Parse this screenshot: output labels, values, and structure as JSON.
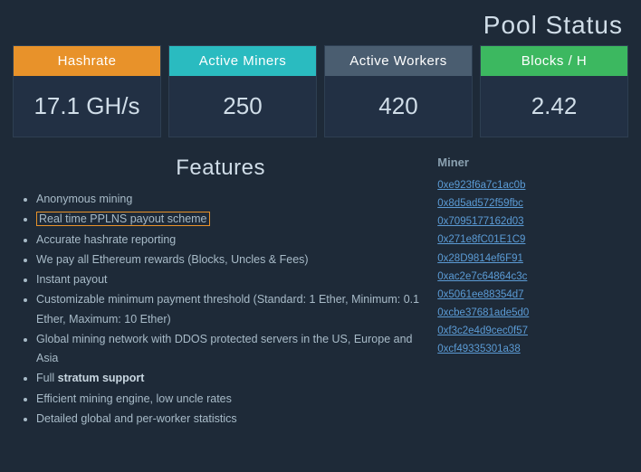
{
  "header": {
    "title": "Pool Status"
  },
  "stats": [
    {
      "id": "hashrate",
      "label": "Hashrate",
      "value": "17.1 GH/s",
      "color": "orange"
    },
    {
      "id": "active-miners",
      "label": "Active Miners",
      "value": "250",
      "color": "teal"
    },
    {
      "id": "active-workers",
      "label": "Active Workers",
      "value": "420",
      "color": "slate"
    },
    {
      "id": "blocks-per-hour",
      "label": "Blocks / H",
      "value": "2.42",
      "color": "green"
    }
  ],
  "features": {
    "title": "Features",
    "items": [
      {
        "text": "Anonymous mining",
        "link": false,
        "bold": false
      },
      {
        "text": "Real time PPLNS payout scheme",
        "link": true,
        "bold": false
      },
      {
        "text": "Accurate hashrate reporting",
        "link": false,
        "bold": false
      },
      {
        "text": "We pay all Ethereum rewards (Blocks, Uncles & Fees)",
        "link": false,
        "bold": false
      },
      {
        "text": "Instant payout",
        "link": false,
        "bold": false
      },
      {
        "text": "Customizable minimum payment threshold (Standard: 1 Ether, Minimum: 0.1 Ether, Maximum: 10 Ether)",
        "link": false,
        "bold": false
      },
      {
        "text": "Global mining network with DDOS protected servers in the US, Europe and Asia",
        "link": false,
        "bold": false
      },
      {
        "text": "Full stratum support",
        "link": false,
        "bold": true,
        "bold_word": "stratum support"
      },
      {
        "text": "Efficient mining engine, low uncle rates",
        "link": false,
        "bold": false
      },
      {
        "text": "Detailed global and per-worker statistics",
        "link": false,
        "bold": false
      }
    ]
  },
  "miners": {
    "header": "Miner",
    "addresses": [
      "0xe923f6a7c1ac0b",
      "0x8d5ad572f59fbc",
      "0x7095177162d03",
      "0x271e8fC01E1C9",
      "0x28D9814ef6F91",
      "0xac2e7c64864c3c",
      "0x5061ee88354d7",
      "0xcbe37681ade5d0",
      "0xf3c2e4d9cec0f57",
      "0xcf49335301a38"
    ]
  }
}
